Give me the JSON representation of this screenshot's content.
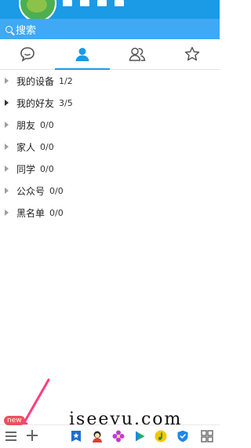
{
  "search": {
    "placeholder": "搜索"
  },
  "tabs": [
    {
      "icon": "chat-bubble-icon"
    },
    {
      "icon": "contacts-person-icon",
      "active": true
    },
    {
      "icon": "groups-icon"
    },
    {
      "icon": "star-icon"
    }
  ],
  "groups": [
    {
      "name": "我的设备",
      "count": "1/2",
      "arrow": "collapsed"
    },
    {
      "name": "我的好友",
      "count": "3/5",
      "arrow": "collapsed"
    },
    {
      "name": "朋友",
      "count": "0/0",
      "arrow": "collapsed"
    },
    {
      "name": "家人",
      "count": "0/0",
      "arrow": "collapsed"
    },
    {
      "name": "同学",
      "count": "0/0",
      "arrow": "collapsed"
    },
    {
      "name": "公众号",
      "count": "0/0",
      "arrow": "collapsed"
    },
    {
      "name": "黑名单",
      "count": "0/0",
      "arrow": "collapsed"
    }
  ],
  "bottom": {
    "badge": "new",
    "apps": [
      "favorites-icon",
      "avatar-app-icon",
      "flower-icon",
      "video-play-icon",
      "music-icon",
      "security-shield-icon",
      "grid-apps-icon"
    ]
  },
  "watermark": "iseeyu.com",
  "colors": {
    "primary": "#1b9ae6",
    "search_bar": "#3fa9f5",
    "badge": "#e9525e",
    "annotation_arrow": "#ff3d7f"
  }
}
